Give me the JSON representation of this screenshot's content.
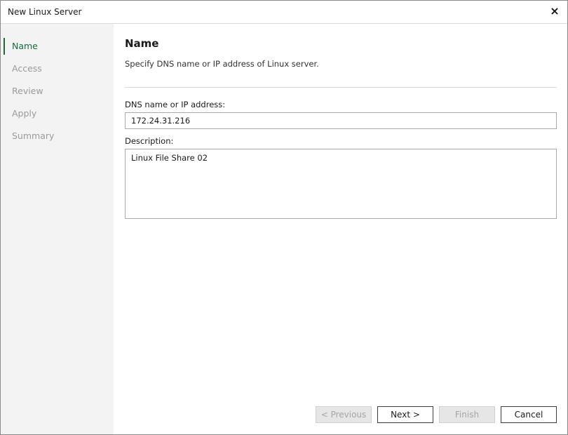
{
  "window": {
    "title": "New Linux Server",
    "close_icon": "×"
  },
  "sidebar": {
    "items": [
      {
        "label": "Name",
        "active": true
      },
      {
        "label": "Access",
        "active": false
      },
      {
        "label": "Review",
        "active": false
      },
      {
        "label": "Apply",
        "active": false
      },
      {
        "label": "Summary",
        "active": false
      }
    ]
  },
  "main": {
    "heading": "Name",
    "subheading": "Specify DNS name or IP address of Linux server.",
    "dns_label": "DNS name or IP address:",
    "dns_value": "172.24.31.216",
    "description_label": "Description:",
    "description_value": "Linux File Share 02"
  },
  "buttons": {
    "previous": "< Previous",
    "next": "Next >",
    "finish": "Finish",
    "cancel": "Cancel"
  },
  "colors": {
    "accent": "#1a6b3a",
    "sidebar_bg": "#f3f3f3",
    "disabled_text": "#a5a5a5"
  }
}
